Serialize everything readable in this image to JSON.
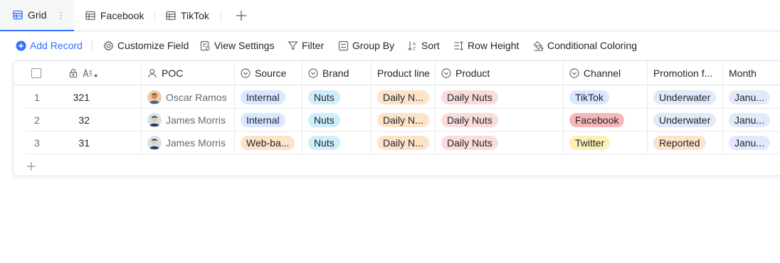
{
  "tabs": [
    {
      "label": "Grid",
      "icon": "grid-icon",
      "active": true
    },
    {
      "label": "Facebook",
      "icon": "grid-icon",
      "active": false
    },
    {
      "label": "TikTok",
      "icon": "grid-icon",
      "active": false
    }
  ],
  "toolbar": {
    "add_record": "Add Record",
    "customize_field": "Customize Field",
    "view_settings": "View Settings",
    "filter": "Filter",
    "group_by": "Group By",
    "sort": "Sort",
    "row_height": "Row Height",
    "conditional_coloring": "Conditional Coloring"
  },
  "columns": {
    "poc": "POC",
    "source": "Source",
    "brand": "Brand",
    "product_line": "Product line",
    "product": "Product",
    "channel": "Channel",
    "promotion": "Promotion f...",
    "month": "Month"
  },
  "rows": [
    {
      "index": "1",
      "number": "321",
      "poc": "Oscar Ramos",
      "source": "Internal",
      "brand": "Nuts",
      "product_line": "Daily N...",
      "product": "Daily Nuts",
      "channel": "TikTok",
      "promotion": "Underwater",
      "month": "Janu..."
    },
    {
      "index": "2",
      "number": "32",
      "poc": "James Morris",
      "source": "Internal",
      "brand": "Nuts",
      "product_line": "Daily N...",
      "product": "Daily Nuts",
      "channel": "Facebook",
      "promotion": "Underwater",
      "month": "Janu..."
    },
    {
      "index": "3",
      "number": "31",
      "poc": "James Morris",
      "source": "Web-ba...",
      "brand": "Nuts",
      "product_line": "Daily N...",
      "product": "Daily Nuts",
      "channel": "Twitter",
      "promotion": "Reported",
      "month": "Janu..."
    }
  ],
  "colors": {
    "accent": "#3370ff",
    "tag_blue": "#d9e8ff",
    "tag_cyan": "#cdeefa",
    "tag_orange": "#fde3c8",
    "tag_pink": "#fbdcdc",
    "tag_red": "#f7b7b7",
    "tag_yellow": "#fdf0b6",
    "tag_lavender": "#e1e9fb"
  }
}
